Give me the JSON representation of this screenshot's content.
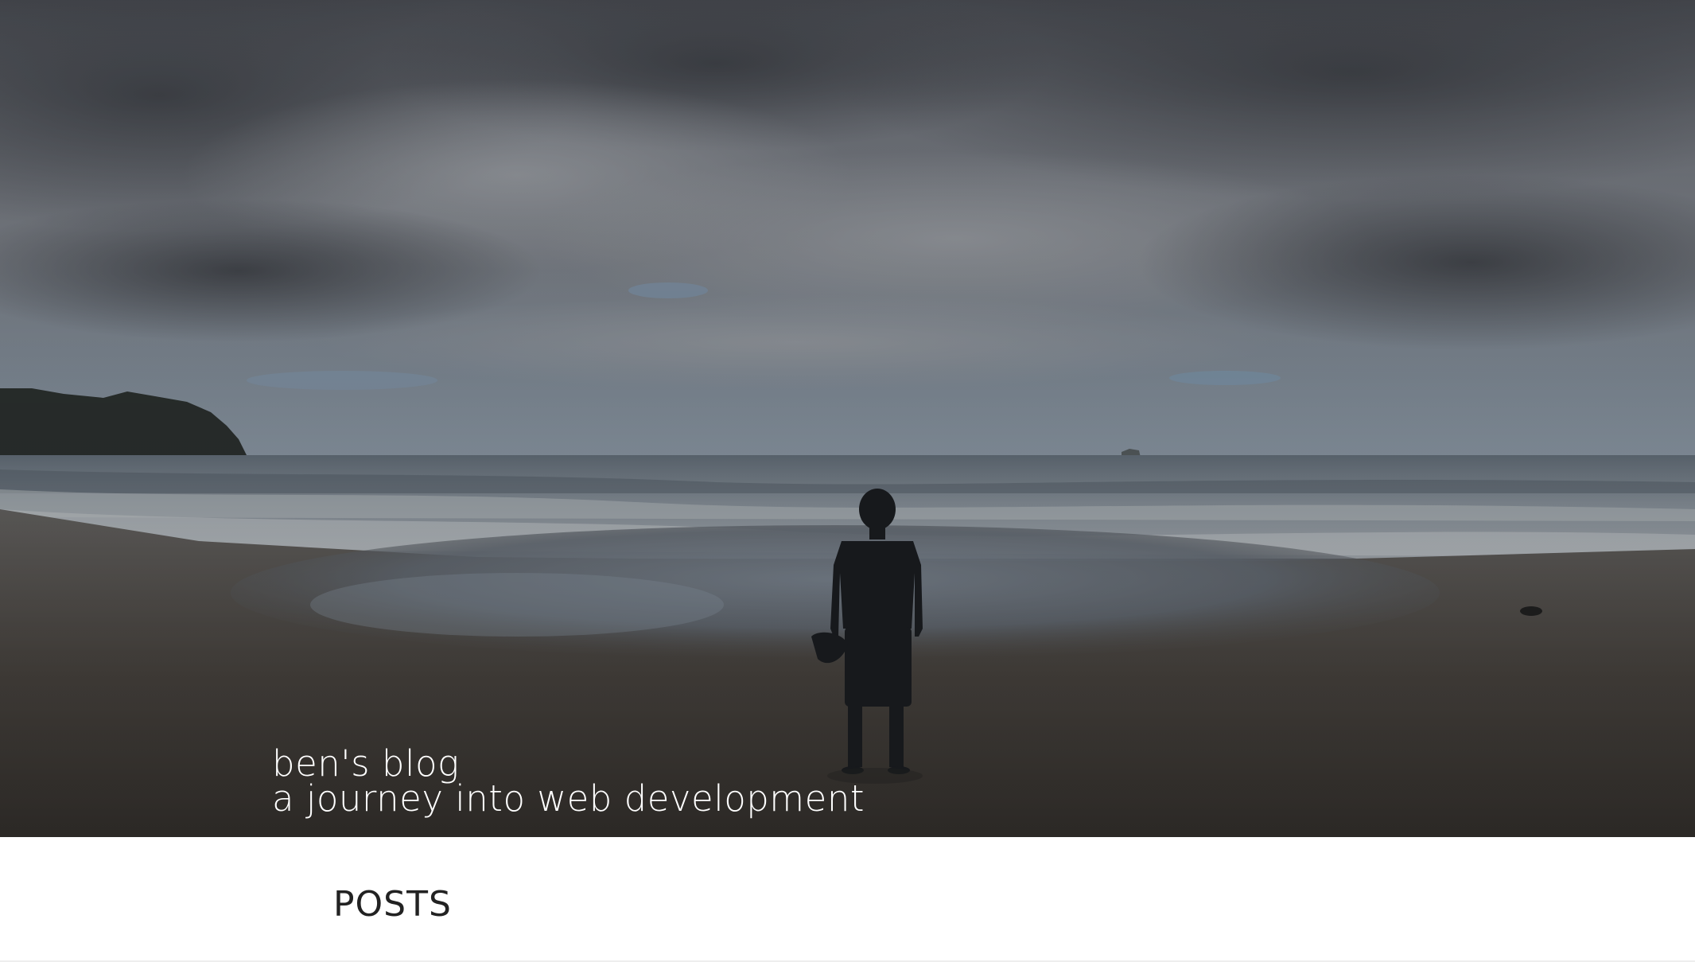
{
  "header": {
    "title": "ben's blog",
    "subtitle": "a journey into web development"
  },
  "nav": {
    "items": [
      {
        "label": "POSTS"
      }
    ]
  },
  "colors": {
    "title_text": "#ffffff",
    "nav_text": "#222222",
    "background": "#ffffff"
  }
}
